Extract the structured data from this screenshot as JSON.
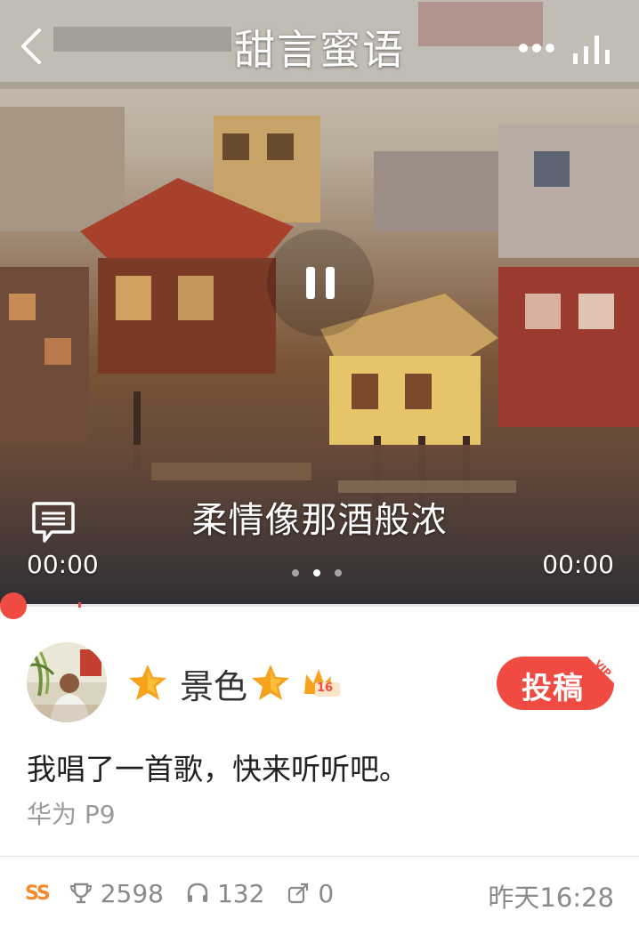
{
  "header": {
    "title": "甜言蜜语"
  },
  "player": {
    "lyric": "柔情像那酒般浓",
    "time_elapsed": "00:00",
    "time_total": "00:00",
    "progress": 0.0,
    "pager": {
      "count": 3,
      "active_index": 1
    }
  },
  "post": {
    "user_name": "景色",
    "level": "16",
    "submit_label": "投稿",
    "vip_label": "VIP",
    "text": "我唱了一首歌，快来听听吧。",
    "device": "华为 P9"
  },
  "footer": {
    "ss_label": "SS",
    "trophy_count": "2598",
    "listen_count": "132",
    "share_count": "0",
    "timestamp": "昨天16:28"
  },
  "colors": {
    "accent": "#ef4b43",
    "star": "#f7a21d",
    "ss": "#f6892a"
  },
  "icons": {
    "back": "back-arrow-icon",
    "more": "more-dots-icon",
    "stats": "stats-bars-icon",
    "pause": "pause-icon",
    "comment": "comment-icon",
    "star": "star-icon",
    "crown": "crown-icon",
    "trophy": "trophy-icon",
    "headphones": "headphones-icon",
    "share": "share-icon"
  }
}
